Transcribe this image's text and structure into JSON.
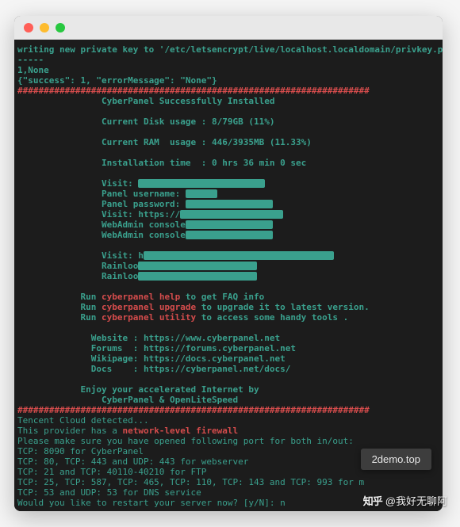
{
  "terminal": {
    "l01": "writing new private key to '/etc/letsencrypt/live/localhost.localdomain/privkey.pem'",
    "l02": "-----",
    "l03": "1,None",
    "l04": "{\"success\": 1, \"errorMessage\": \"None\"}",
    "hash": "###################################################################",
    "title_installed": "                CyberPanel Successfully Installed                ",
    "disk": "                Current Disk usage : 8/79GB (11%)                ",
    "ram": "                Current RAM  usage : 446/3935MB (11.33%)                ",
    "time": "                Installation time  : 0 hrs 36 min 0 sec                ",
    "visit_lbl": "                Visit: ",
    "panel_user": "                Panel username: ",
    "panel_pass": "                Panel password: ",
    "visit2": "                Visit: https://",
    "webadmin_c": "                WebAdmin console",
    "webadmin_c2": "                WebAdmin console",
    "visit3": "                Visit: h",
    "rainloo1": "                Rainloo",
    "rainloo2": "                Rainloo",
    "run": "            Run ",
    "cp_help": "cyberpanel help",
    "faq_tail": " to get FAQ info",
    "cp_upgrade": "cyberpanel upgrade",
    "upgrade_tail": " to upgrade it to latest version.",
    "cp_utility": "cyberpanel utility",
    "utility_tail": " to access some handy tools .",
    "website": "              Website : https://www.cyberpanel.net               ",
    "forums": "              Forums  : https://forums.cyberpanel.net              ",
    "wikipage": "              Wikipage: https://docs.cyberpanel.net                ",
    "docs": "              Docs    : https://cyberpanel.net/docs/               ",
    "accel": "            Enjoy your accelerated Internet by                  ",
    "ols": "                CyberPanel & OpenLiteSpeed                     ",
    "tencent": "Tencent Cloud detected...",
    "provider_a": "This provider has a ",
    "provider_b": "network-level firewall",
    "ports_open": "Please make sure you have opened following port for both in/out:",
    "p1": "TCP: 8090 for CyberPanel",
    "p2": "TCP: 80, TCP: 443 and UDP: 443 for webserver",
    "p3": "TCP: 21 and TCP: 40110-40210 for FTP",
    "p4": "TCP: 25, TCP: 587, TCP: 465, TCP: 110, TCP: 143 and TCP: 993 for m",
    "p5": "TCP: 53 and UDP: 53 for DNS service",
    "restart": "Would you like to restart your server now? [y/N]: n"
  },
  "overlay": {
    "text": "2demo.top"
  },
  "watermark": {
    "logo": "知乎",
    "user": "@我好无聊阿"
  }
}
